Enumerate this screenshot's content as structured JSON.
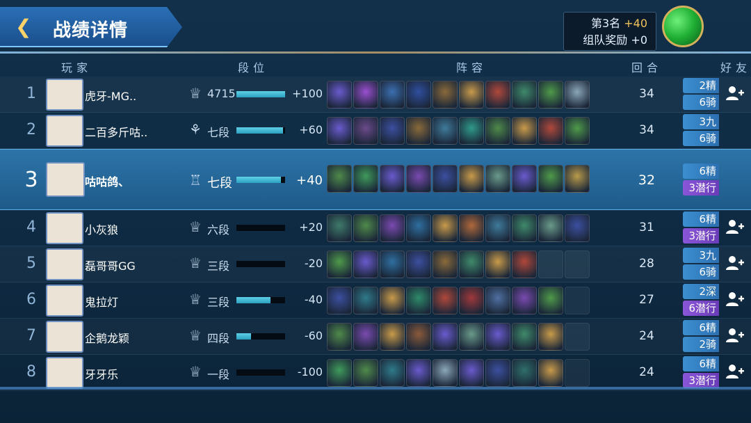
{
  "header": {
    "title": "战绩详情",
    "rank_text": "第3名",
    "rank_points": "+40",
    "team_reward_label": "组队奖励",
    "team_reward_value": "+0"
  },
  "columns": {
    "player": "玩家",
    "tier": "段位",
    "lineup": "阵容",
    "round": "回合",
    "friend": "好友"
  },
  "colors": {
    "accent": "#2d74a8",
    "bar": "#2ba0c0",
    "gold": "#f0c35a"
  },
  "rows": [
    {
      "rank": "1",
      "name": "虎牙-MG..",
      "tier_icon": "♕",
      "tier": "4715",
      "progress": 1.0,
      "delta": "+100",
      "lineup": [
        "#6a5acd",
        "#9a4fd0",
        "#3c6fb0",
        "#2f4f9f",
        "#8a6a3a",
        "#c89a4a",
        "#b0483a",
        "#3f8a6a",
        "#4f9a4a",
        "#8aa6b8"
      ],
      "round": "34",
      "traits": [
        {
          "text": "2精",
          "color": "blue"
        },
        {
          "text": "6骑",
          "color": "blue"
        }
      ],
      "me": false,
      "friend": true
    },
    {
      "rank": "2",
      "name": "二百多斤咕..",
      "tier_icon": "⚘",
      "tier": "七段",
      "progress": 0.95,
      "delta": "+60",
      "lineup": [
        "#6a5acd",
        "#6b4a8a",
        "#3c4f9f",
        "#8a6a3a",
        "#3f7a9a",
        "#2f9a8a",
        "#4f8a4a",
        "#c89a4a",
        "#b0483a",
        "#4f9a4a"
      ],
      "round": "34",
      "traits": [
        {
          "text": "3九",
          "color": "blue"
        },
        {
          "text": "6骑",
          "color": "blue"
        }
      ],
      "me": false,
      "friend": false
    },
    {
      "rank": "3",
      "name": "咕咕鸽、",
      "tier_icon": "♖",
      "tier": "七段",
      "progress": 0.92,
      "delta": "+40",
      "lineup": [
        "#4f8a4a",
        "#3f9a5a",
        "#6a5acd",
        "#7a4ab0",
        "#3c4f9f",
        "#c89a4a",
        "#6a9a8a",
        "#6a5acd",
        "#4f9a4a",
        "#b89a4a"
      ],
      "round": "32",
      "traits": [
        {
          "text": "6精",
          "color": "blue"
        },
        {
          "text": "3潜行",
          "color": "purple"
        }
      ],
      "me": true,
      "friend": false
    },
    {
      "rank": "4",
      "name": "小灰狼",
      "tier_icon": "♕",
      "tier": "六段",
      "progress": 0.0,
      "delta": "+20",
      "lineup": [
        "#3f7a6a",
        "#4f8a4a",
        "#7a4ab0",
        "#2f6fa0",
        "#c89a4a",
        "#b0683a",
        "#3f7a9a",
        "#3f8a6a",
        "#6a9a8a",
        "#3c4f9f"
      ],
      "round": "31",
      "traits": [
        {
          "text": "6精",
          "color": "blue"
        },
        {
          "text": "3潜行",
          "color": "purple"
        }
      ],
      "me": false,
      "friend": true
    },
    {
      "rank": "5",
      "name": "磊哥哥GG",
      "tier_icon": "♕",
      "tier": "三段",
      "progress": 0.0,
      "delta": "-20",
      "lineup": [
        "#4f9a4a",
        "#6a5acd",
        "#2f6fa0",
        "#3c4f9f",
        "#8a6a3a",
        "#3f8a6a",
        "#c89a4a",
        "#b0483a"
      ],
      "round": "28",
      "traits": [
        {
          "text": "3九",
          "color": "blue"
        },
        {
          "text": "6骑",
          "color": "blue"
        }
      ],
      "me": false,
      "friend": true
    },
    {
      "rank": "6",
      "name": "鬼拉灯",
      "tier_icon": "♕",
      "tier": "三段",
      "progress": 0.7,
      "delta": "-40",
      "lineup": [
        "#3c4f9f",
        "#2f7a8a",
        "#c89a4a",
        "#2f8a6a",
        "#b0483a",
        "#a0383a",
        "#4f6fa0",
        "#7a4ab0",
        "#4f9a4a"
      ],
      "round": "27",
      "traits": [
        {
          "text": "2深",
          "color": "blue"
        },
        {
          "text": "6潜行",
          "color": "purple"
        }
      ],
      "me": false,
      "friend": true
    },
    {
      "rank": "7",
      "name": "企鹅龙颖",
      "tier_icon": "♕",
      "tier": "四段",
      "progress": 0.3,
      "delta": "-60",
      "lineup": [
        "#4f8a4a",
        "#7a4ab0",
        "#c89a4a",
        "#8a5a3a",
        "#6a5acd",
        "#6a9a8a",
        "#6a5acd",
        "#3f8a6a",
        "#c89a4a"
      ],
      "round": "24",
      "traits": [
        {
          "text": "6精",
          "color": "blue"
        },
        {
          "text": "2骑",
          "color": "blue"
        }
      ],
      "me": false,
      "friend": true
    },
    {
      "rank": "8",
      "name": "牙牙乐",
      "tier_icon": "♕",
      "tier": "一段",
      "progress": 0.0,
      "delta": "-100",
      "lineup": [
        "#3f9a5a",
        "#4f8a4a",
        "#2f7a8a",
        "#6a5acd",
        "#8aa6b8",
        "#6a5acd",
        "#3c4f9f",
        "#2f6f6a",
        "#c89a4a"
      ],
      "round": "24",
      "traits": [
        {
          "text": "6精",
          "color": "blue"
        },
        {
          "text": "3潜行",
          "color": "purple"
        }
      ],
      "me": false,
      "friend": true
    }
  ]
}
